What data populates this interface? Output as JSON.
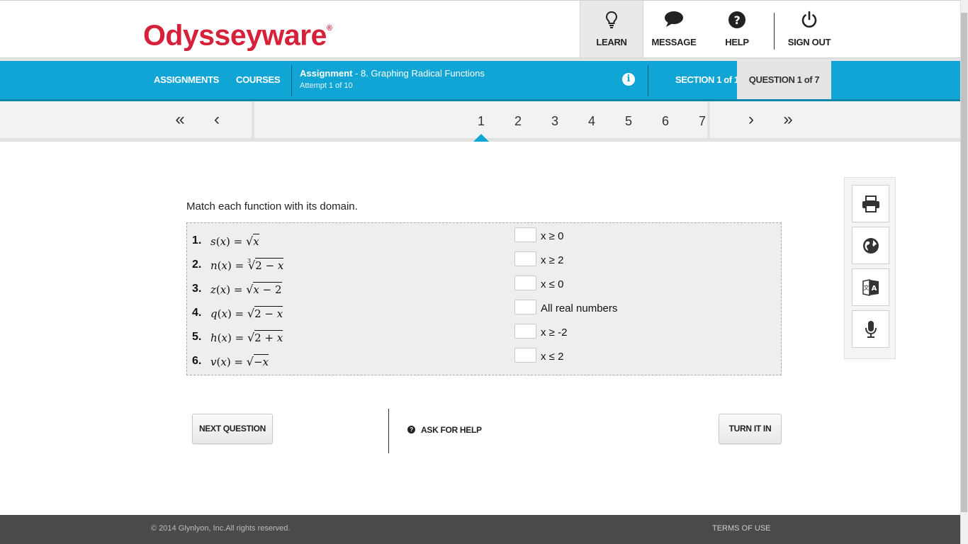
{
  "header": {
    "logo": "Odysseyware",
    "logo_mark": "®",
    "nav": {
      "learn": "LEARN",
      "message": "MESSAGE",
      "help": "HELP",
      "signout": "SIGN OUT"
    }
  },
  "bluebar": {
    "assignments": "ASSIGNMENTS",
    "courses": "COURSES",
    "assignment_label": "Assignment",
    "assignment_name": " - 8. Graphing Radical Functions",
    "attempt": "Attempt 1 of 10",
    "section": "SECTION 1 of 1",
    "question": "QUESTION 1 of 7"
  },
  "pager": {
    "first": "«",
    "prev": "‹",
    "pages": [
      "1",
      "2",
      "3",
      "4",
      "5",
      "6",
      "7"
    ],
    "active_page": "1",
    "next": "›",
    "last": "»"
  },
  "question": {
    "prompt": "Match each function with its domain.",
    "functions": [
      {
        "num": "1.",
        "name": "s"
      },
      {
        "num": "2.",
        "name": "n"
      },
      {
        "num": "3.",
        "name": "z"
      },
      {
        "num": "4.",
        "name": "q"
      },
      {
        "num": "5.",
        "name": "h"
      },
      {
        "num": "6.",
        "name": "v"
      }
    ],
    "domains": [
      "x ≥ 0",
      "x ≥ 2",
      "x ≤ 0",
      "All real numbers",
      "x ≥ -2",
      "x ≤ 2"
    ]
  },
  "actions": {
    "next_question": "NEXT QUESTION",
    "ask_for_help": "ASK FOR HELP",
    "ask_icon": "?",
    "turn_it_in": "TURN IT IN"
  },
  "tools": [
    "print-icon",
    "globe-icon",
    "translate-icon",
    "microphone-icon"
  ],
  "footer": {
    "copyright": "© 2014 Glynlyon, Inc.All rights reserved.",
    "terms": "TERMS OF USE"
  },
  "colors": {
    "brand_red": "#d5213a",
    "accent_blue": "#10a5d5",
    "footer_gray": "#4a4a4a"
  }
}
